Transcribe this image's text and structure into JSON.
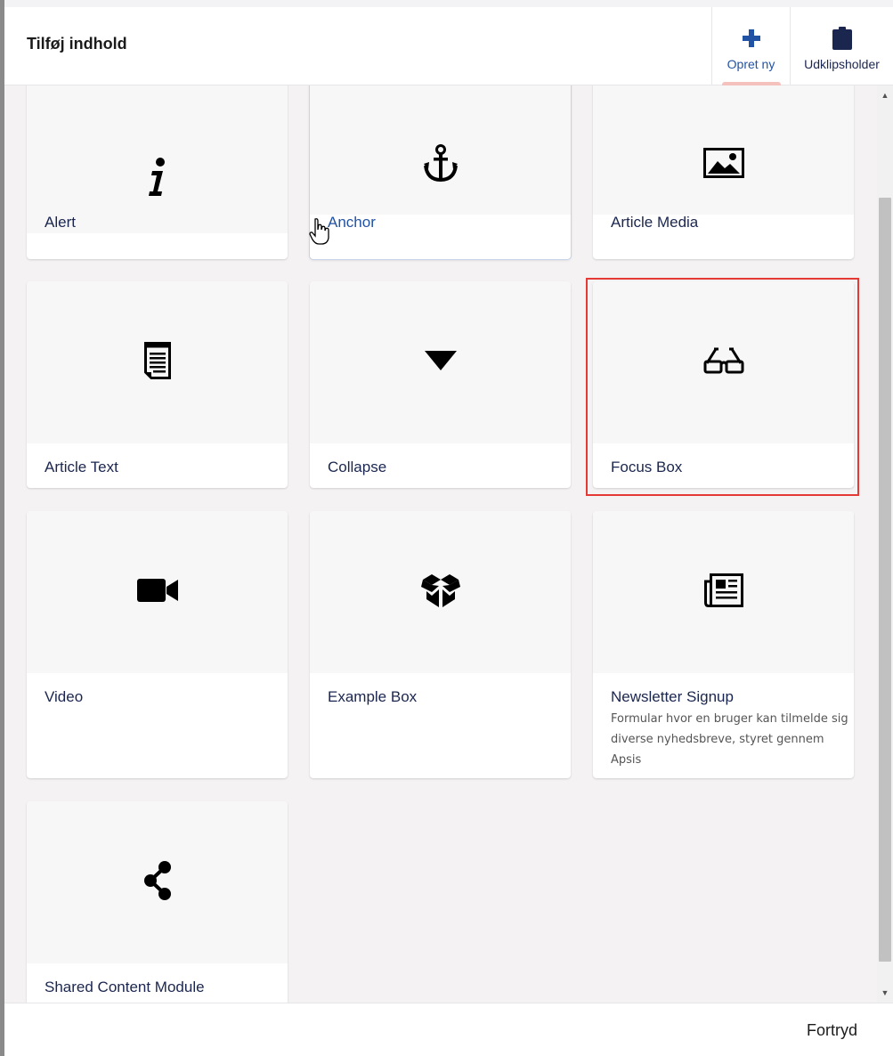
{
  "dialog": {
    "title": "Tilføj indhold"
  },
  "header_tabs": {
    "create": {
      "label": "Opret ny",
      "icon": "plus-icon",
      "active": true
    },
    "clipboard": {
      "label": "Udklipsholder",
      "icon": "clipboard-icon"
    }
  },
  "cards": [
    {
      "title": "Alert",
      "icon": "info-icon"
    },
    {
      "title": "Anchor",
      "icon": "anchor-icon"
    },
    {
      "title": "Article Media",
      "icon": "image-icon"
    },
    {
      "title": "Article Text",
      "icon": "document-text-icon"
    },
    {
      "title": "Collapse",
      "icon": "caret-down-icon"
    },
    {
      "title": "Focus Box",
      "icon": "glasses-icon"
    },
    {
      "title": "Video",
      "icon": "video-camera-icon"
    },
    {
      "title": "Example Box",
      "icon": "box-icon"
    },
    {
      "title": "Newsletter Signup",
      "icon": "newspaper-icon",
      "description": "Formular hvor en bruger kan tilmelde sig diverse nyhedsbreve, styret gennem Apsis"
    },
    {
      "title": "Shared Content Module",
      "icon": "share-icon"
    }
  ],
  "footer": {
    "cancel_label": "Fortryd"
  },
  "colors": {
    "accent": "#2152a3",
    "tab_indicator": "#f5c1bc",
    "highlight": "#e53935",
    "text": "#1b264f",
    "content_bg": "#f4f2f2"
  }
}
